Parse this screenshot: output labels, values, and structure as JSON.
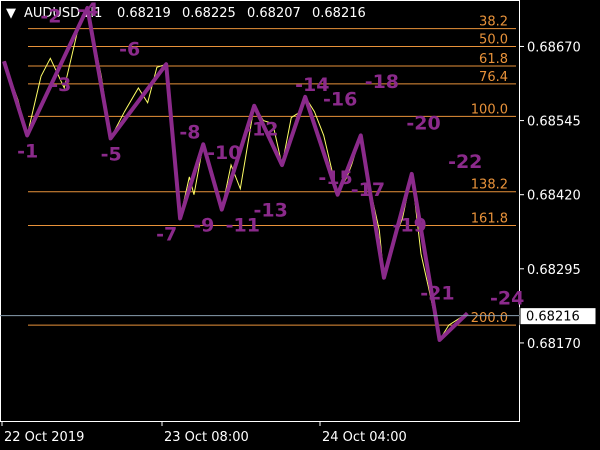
{
  "header": {
    "arrow": "▼",
    "symbol": "AUDUSD,H1",
    "open": "0.68219",
    "high": "0.68225",
    "low": "0.68207",
    "close": "0.68216"
  },
  "colors": {
    "background": "#000000",
    "fib_line": "#e8923a",
    "zigzag_thick": "#8b2a8b",
    "zigzag_thin": "#8b2a8b",
    "price_line": "#ffff66",
    "axis": "#ffffff",
    "current_price_line": "#8a9fb0"
  },
  "chart_data": {
    "type": "line",
    "title": "AUDUSD,H1",
    "xlabel": "",
    "ylabel": "",
    "ylim": [
      0.6804,
      0.68745
    ],
    "y_ticks": [
      "0.68670",
      "0.68545",
      "0.68420",
      "0.68295",
      "0.68170"
    ],
    "x_ticks": [
      "22 Oct 2019",
      "23 Oct 08:00",
      "24 Oct 04:00"
    ],
    "current_price": "0.68216",
    "fib_levels": [
      {
        "label": "38.2",
        "price": 0.687
      },
      {
        "label": "50.0",
        "price": 0.6867
      },
      {
        "label": "61.8",
        "price": 0.68637
      },
      {
        "label": "76.4",
        "price": 0.68607
      },
      {
        "label": "100.0",
        "price": 0.68552
      },
      {
        "label": "138.2",
        "price": 0.68425
      },
      {
        "label": "161.8",
        "price": 0.68368
      },
      {
        "label": "200.0",
        "price": 0.682
      }
    ],
    "series": [
      {
        "name": "ZigZag",
        "x": [
          0,
          5,
          18,
          23,
          35,
          38,
          43,
          47,
          54,
          60,
          65,
          72,
          77,
          82,
          88,
          94,
          100
        ],
        "y": [
          0.68645,
          0.6852,
          0.68735,
          0.68515,
          0.6864,
          0.6838,
          0.68505,
          0.68395,
          0.6857,
          0.6847,
          0.68585,
          0.6842,
          0.6852,
          0.6828,
          0.68455,
          0.68175,
          0.6822
        ]
      },
      {
        "name": "Price",
        "x": [
          0,
          3,
          5,
          8,
          10,
          13,
          16,
          18,
          21,
          23,
          26,
          29,
          31,
          33,
          35,
          37,
          38,
          40,
          41,
          43,
          45,
          47,
          49,
          51,
          54,
          56,
          58,
          60,
          62,
          64,
          65,
          67,
          69,
          72,
          74,
          75,
          77,
          79,
          81,
          82,
          84,
          86,
          88,
          90,
          92,
          94,
          96,
          98,
          100
        ],
        "y": [
          0.68645,
          0.6858,
          0.6852,
          0.6862,
          0.6865,
          0.686,
          0.687,
          0.68735,
          0.6862,
          0.68515,
          0.6856,
          0.686,
          0.68575,
          0.68635,
          0.6864,
          0.6847,
          0.6838,
          0.6845,
          0.6842,
          0.68505,
          0.6845,
          0.68395,
          0.6847,
          0.6843,
          0.6857,
          0.68545,
          0.6854,
          0.6847,
          0.6855,
          0.6856,
          0.68585,
          0.6856,
          0.6852,
          0.6842,
          0.6845,
          0.6847,
          0.6852,
          0.6843,
          0.6836,
          0.6828,
          0.6834,
          0.6838,
          0.68455,
          0.6832,
          0.6825,
          0.68175,
          0.682,
          0.6821,
          0.6822
        ]
      }
    ],
    "zigzag_labels": [
      {
        "label": "-1",
        "x": 5,
        "y": 0.6852,
        "pos": "below"
      },
      {
        "label": "-2",
        "x": 10,
        "y": 0.687,
        "pos": "above"
      },
      {
        "label": "-3",
        "x": 13,
        "y": 0.68605,
        "pos": "left"
      },
      {
        "label": "-4",
        "x": 18,
        "y": 0.68735,
        "pos": "above"
      },
      {
        "label": "-5",
        "x": 23,
        "y": 0.68515,
        "pos": "below"
      },
      {
        "label": "-6",
        "x": 27,
        "y": 0.68645,
        "pos": "above"
      },
      {
        "label": "-7",
        "x": 35,
        "y": 0.6838,
        "pos": "below"
      },
      {
        "label": "-8",
        "x": 40,
        "y": 0.68505,
        "pos": "above"
      },
      {
        "label": "-9",
        "x": 43,
        "y": 0.68395,
        "pos": "below"
      },
      {
        "label": "-10",
        "x": 46,
        "y": 0.6847,
        "pos": "above"
      },
      {
        "label": "-11",
        "x": 50,
        "y": 0.68395,
        "pos": "below"
      },
      {
        "label": "-12",
        "x": 54,
        "y": 0.6851,
        "pos": "above"
      },
      {
        "label": "-13",
        "x": 56,
        "y": 0.6842,
        "pos": "below"
      },
      {
        "label": "-14",
        "x": 65,
        "y": 0.68585,
        "pos": "above"
      },
      {
        "label": "-15",
        "x": 70,
        "y": 0.68475,
        "pos": "below"
      },
      {
        "label": "-16",
        "x": 71,
        "y": 0.6856,
        "pos": "above"
      },
      {
        "label": "-17",
        "x": 77,
        "y": 0.68455,
        "pos": "below"
      },
      {
        "label": "-18",
        "x": 80,
        "y": 0.6859,
        "pos": "above"
      },
      {
        "label": "-19",
        "x": 86,
        "y": 0.68395,
        "pos": "below"
      },
      {
        "label": "-20",
        "x": 89,
        "y": 0.6852,
        "pos": "above"
      },
      {
        "label": "-21",
        "x": 92,
        "y": 0.6828,
        "pos": "below"
      },
      {
        "label": "-22",
        "x": 98,
        "y": 0.68455,
        "pos": "above"
      },
      {
        "label": "-24",
        "x": 110,
        "y": 0.68225,
        "pos": "above"
      }
    ]
  }
}
